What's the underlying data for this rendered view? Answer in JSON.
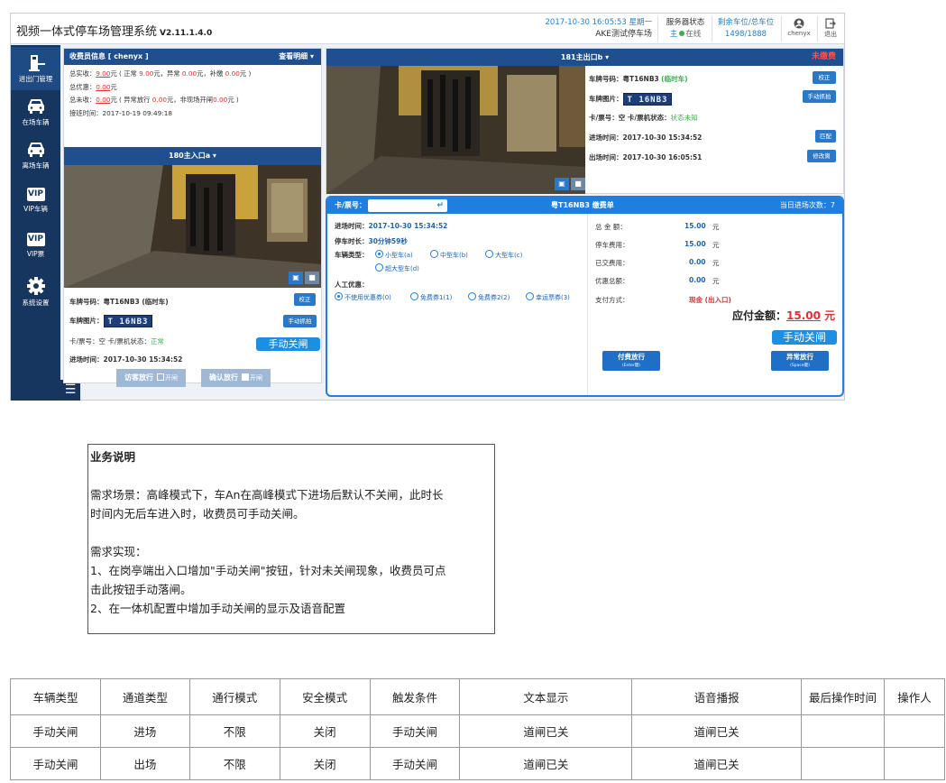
{
  "app": {
    "title": "视频一体式停车场管理系统",
    "version": "V2.11.1.4.0",
    "datetime": "2017-10-30 16:05:53 星期一",
    "lot_name": "AKE测试停车场",
    "server_status_label": "服务器状态",
    "server_main": "主",
    "server_online": "在线",
    "space_label": "剩余车位/总车位",
    "space_value": "1498/1888",
    "username": "chenyx",
    "exit_label": "退出"
  },
  "sidebar": {
    "items": [
      {
        "label": "进出门管理",
        "icon": "gate-icon"
      },
      {
        "label": "在场车辆",
        "icon": "car-icon"
      },
      {
        "label": "离场车辆",
        "icon": "car-exit-icon"
      },
      {
        "label": "VIP车辆",
        "icon": "vip-icon"
      },
      {
        "label": "VIP票",
        "icon": "vip-ticket-icon"
      },
      {
        "label": "系统设置",
        "icon": "gear-icon"
      }
    ],
    "vip_text": "VIP"
  },
  "cashier": {
    "header": "收费员信息 [ chenyx ]",
    "detail_link": "查看明细",
    "line1_pre": "总实收：",
    "line1_total": "9.00",
    "line1_mid": "元 ( 正常 ",
    "line1_normal": "9.00",
    "line1_mid2": "元，异常 ",
    "line1_abnormal": "0.00",
    "line1_mid3": "元，补缴 ",
    "line1_supp": "0.00",
    "line1_end": "元 )",
    "line2_pre": "总优惠：",
    "line2_val": "0.00",
    "line2_end": "元",
    "line3_pre": "总未收：",
    "line3_val": "0.00",
    "line3_mid": "元 ( 异常放行 ",
    "line3_v1": "0.00",
    "line3_mid2": "元，非现场开闸",
    "line3_v2": "0.00",
    "line3_end": "元 )",
    "shift_label": "接班时间：",
    "shift_time": "2017-10-19 09:49:18"
  },
  "entrance": {
    "camera_title": "180主入口a ▾",
    "plate_label": "车牌号码：",
    "plate_value": "粤T16NB3 (临时车)",
    "correct_btn": "校正",
    "plate_img_label": "车牌图片：",
    "plate_img_text": "T 16NB3",
    "manual_capture_btn": "手动抓拍",
    "card_label": "卡/票号：空    卡/票机状态：",
    "card_status": "正常",
    "manual_close_btn": "手动关闸",
    "entry_time_label": "进场时间：",
    "entry_time": "2017-10-30 15:34:52",
    "visitor_btn": "访客放行",
    "confirm_btn": "确认放行",
    "kaizha": "开闸"
  },
  "exit": {
    "camera_title": "181主出口b ▾",
    "status": "未缴费",
    "plate_label": "车牌号码：",
    "plate_value": "粤T16NB3",
    "plate_type": "(临时车)",
    "correct_btn": "校正",
    "plate_img_label": "车牌图片：",
    "plate_img_text": "T 16NB3",
    "capture_btn": "手动抓拍",
    "card_label": "卡/票号：空    卡/票机状态：",
    "card_status": "状态未知",
    "entry_label": "进场时间：",
    "entry_time": "2017-10-30 15:34:52",
    "match_btn": "匹配",
    "exit_label": "出场时间：",
    "exit_time": "2017-10-30 16:05:51",
    "modify_btn": "修改离"
  },
  "payment": {
    "card_label": "卡/票号：",
    "card_input_value": "↵",
    "title": "粤T16NB3  缴费单",
    "count_label": "当日进场次数：7",
    "entry_label": "进场时间：",
    "entry_time": "2017-10-30 15:34:52",
    "duration_label": "停车时长：",
    "duration": "30分钟59秒",
    "vehicle_type_label": "车辆类型：",
    "vehicle_types": [
      "小型车(a)",
      "中型车(b)",
      "大型车(c)",
      "超大型车(d)"
    ],
    "discount_label": "人工优惠：",
    "discounts": [
      "不使用优惠券(0)",
      "免费券1(1)",
      "免费券2(2)",
      "幸运票券(3)"
    ],
    "total_label": "总 金 额：",
    "total": "15.00",
    "fee_label": "停车费用：",
    "fee": "15.00",
    "paid_label": "已交费用：",
    "paid": "0.00",
    "disc_total_label": "优惠总额：",
    "disc_total": "0.00",
    "unit": "元",
    "pay_method_label": "支付方式：",
    "pay_method": "现金 (出入口)",
    "due_label": "应付金额：",
    "due_value": "15.00",
    "due_unit": "元",
    "manual_close_btn": "手动关闸",
    "pay_release_btn": "付费放行",
    "pay_release_hint": "(Enter键)",
    "abnormal_release_btn": "异常放行",
    "abnormal_release_hint": "(Space键)"
  },
  "description": {
    "title": "业务说明",
    "scene1": "需求场景：高峰模式下，车An在高峰模式下进场后默认不关闸，此时长",
    "scene2": "时间内无后车进入时，收费员可手动关闸。",
    "impl_title": "需求实现：",
    "impl1a": "1、在岗亭端出入口增加\"手动关闸\"按钮，针对未关闸现象，收费员可点",
    "impl1b": "击此按钮手动落闸。",
    "impl2": "2、在一体机配置中增加手动关闸的显示及语音配置"
  },
  "table": {
    "headers": [
      "车辆类型",
      "通道类型",
      "通行模式",
      "安全模式",
      "触发条件",
      "文本显示",
      "语音播报",
      "最后操作时间",
      "操作人"
    ],
    "rows": [
      [
        "手动关闸",
        "进场",
        "不限",
        "关闭",
        "手动关闸",
        "道闸已关",
        "道闸已关",
        "",
        ""
      ],
      [
        "手动关闸",
        "出场",
        "不限",
        "关闭",
        "手动关闸",
        "道闸已关",
        "道闸已关",
        "",
        ""
      ]
    ]
  }
}
